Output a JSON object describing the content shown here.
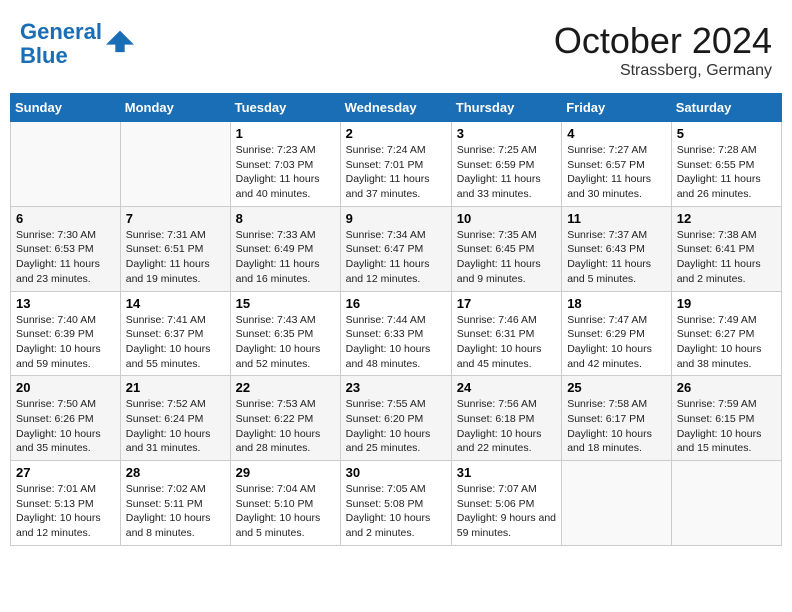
{
  "header": {
    "logo_line1": "General",
    "logo_line2": "Blue",
    "month_title": "October 2024",
    "location": "Strassberg, Germany"
  },
  "weekdays": [
    "Sunday",
    "Monday",
    "Tuesday",
    "Wednesday",
    "Thursday",
    "Friday",
    "Saturday"
  ],
  "weeks": [
    [
      {
        "day": "",
        "sunrise": "",
        "sunset": "",
        "daylight": ""
      },
      {
        "day": "",
        "sunrise": "",
        "sunset": "",
        "daylight": ""
      },
      {
        "day": "1",
        "sunrise": "Sunrise: 7:23 AM",
        "sunset": "Sunset: 7:03 PM",
        "daylight": "Daylight: 11 hours and 40 minutes."
      },
      {
        "day": "2",
        "sunrise": "Sunrise: 7:24 AM",
        "sunset": "Sunset: 7:01 PM",
        "daylight": "Daylight: 11 hours and 37 minutes."
      },
      {
        "day": "3",
        "sunrise": "Sunrise: 7:25 AM",
        "sunset": "Sunset: 6:59 PM",
        "daylight": "Daylight: 11 hours and 33 minutes."
      },
      {
        "day": "4",
        "sunrise": "Sunrise: 7:27 AM",
        "sunset": "Sunset: 6:57 PM",
        "daylight": "Daylight: 11 hours and 30 minutes."
      },
      {
        "day": "5",
        "sunrise": "Sunrise: 7:28 AM",
        "sunset": "Sunset: 6:55 PM",
        "daylight": "Daylight: 11 hours and 26 minutes."
      }
    ],
    [
      {
        "day": "6",
        "sunrise": "Sunrise: 7:30 AM",
        "sunset": "Sunset: 6:53 PM",
        "daylight": "Daylight: 11 hours and 23 minutes."
      },
      {
        "day": "7",
        "sunrise": "Sunrise: 7:31 AM",
        "sunset": "Sunset: 6:51 PM",
        "daylight": "Daylight: 11 hours and 19 minutes."
      },
      {
        "day": "8",
        "sunrise": "Sunrise: 7:33 AM",
        "sunset": "Sunset: 6:49 PM",
        "daylight": "Daylight: 11 hours and 16 minutes."
      },
      {
        "day": "9",
        "sunrise": "Sunrise: 7:34 AM",
        "sunset": "Sunset: 6:47 PM",
        "daylight": "Daylight: 11 hours and 12 minutes."
      },
      {
        "day": "10",
        "sunrise": "Sunrise: 7:35 AM",
        "sunset": "Sunset: 6:45 PM",
        "daylight": "Daylight: 11 hours and 9 minutes."
      },
      {
        "day": "11",
        "sunrise": "Sunrise: 7:37 AM",
        "sunset": "Sunset: 6:43 PM",
        "daylight": "Daylight: 11 hours and 5 minutes."
      },
      {
        "day": "12",
        "sunrise": "Sunrise: 7:38 AM",
        "sunset": "Sunset: 6:41 PM",
        "daylight": "Daylight: 11 hours and 2 minutes."
      }
    ],
    [
      {
        "day": "13",
        "sunrise": "Sunrise: 7:40 AM",
        "sunset": "Sunset: 6:39 PM",
        "daylight": "Daylight: 10 hours and 59 minutes."
      },
      {
        "day": "14",
        "sunrise": "Sunrise: 7:41 AM",
        "sunset": "Sunset: 6:37 PM",
        "daylight": "Daylight: 10 hours and 55 minutes."
      },
      {
        "day": "15",
        "sunrise": "Sunrise: 7:43 AM",
        "sunset": "Sunset: 6:35 PM",
        "daylight": "Daylight: 10 hours and 52 minutes."
      },
      {
        "day": "16",
        "sunrise": "Sunrise: 7:44 AM",
        "sunset": "Sunset: 6:33 PM",
        "daylight": "Daylight: 10 hours and 48 minutes."
      },
      {
        "day": "17",
        "sunrise": "Sunrise: 7:46 AM",
        "sunset": "Sunset: 6:31 PM",
        "daylight": "Daylight: 10 hours and 45 minutes."
      },
      {
        "day": "18",
        "sunrise": "Sunrise: 7:47 AM",
        "sunset": "Sunset: 6:29 PM",
        "daylight": "Daylight: 10 hours and 42 minutes."
      },
      {
        "day": "19",
        "sunrise": "Sunrise: 7:49 AM",
        "sunset": "Sunset: 6:27 PM",
        "daylight": "Daylight: 10 hours and 38 minutes."
      }
    ],
    [
      {
        "day": "20",
        "sunrise": "Sunrise: 7:50 AM",
        "sunset": "Sunset: 6:26 PM",
        "daylight": "Daylight: 10 hours and 35 minutes."
      },
      {
        "day": "21",
        "sunrise": "Sunrise: 7:52 AM",
        "sunset": "Sunset: 6:24 PM",
        "daylight": "Daylight: 10 hours and 31 minutes."
      },
      {
        "day": "22",
        "sunrise": "Sunrise: 7:53 AM",
        "sunset": "Sunset: 6:22 PM",
        "daylight": "Daylight: 10 hours and 28 minutes."
      },
      {
        "day": "23",
        "sunrise": "Sunrise: 7:55 AM",
        "sunset": "Sunset: 6:20 PM",
        "daylight": "Daylight: 10 hours and 25 minutes."
      },
      {
        "day": "24",
        "sunrise": "Sunrise: 7:56 AM",
        "sunset": "Sunset: 6:18 PM",
        "daylight": "Daylight: 10 hours and 22 minutes."
      },
      {
        "day": "25",
        "sunrise": "Sunrise: 7:58 AM",
        "sunset": "Sunset: 6:17 PM",
        "daylight": "Daylight: 10 hours and 18 minutes."
      },
      {
        "day": "26",
        "sunrise": "Sunrise: 7:59 AM",
        "sunset": "Sunset: 6:15 PM",
        "daylight": "Daylight: 10 hours and 15 minutes."
      }
    ],
    [
      {
        "day": "27",
        "sunrise": "Sunrise: 7:01 AM",
        "sunset": "Sunset: 5:13 PM",
        "daylight": "Daylight: 10 hours and 12 minutes."
      },
      {
        "day": "28",
        "sunrise": "Sunrise: 7:02 AM",
        "sunset": "Sunset: 5:11 PM",
        "daylight": "Daylight: 10 hours and 8 minutes."
      },
      {
        "day": "29",
        "sunrise": "Sunrise: 7:04 AM",
        "sunset": "Sunset: 5:10 PM",
        "daylight": "Daylight: 10 hours and 5 minutes."
      },
      {
        "day": "30",
        "sunrise": "Sunrise: 7:05 AM",
        "sunset": "Sunset: 5:08 PM",
        "daylight": "Daylight: 10 hours and 2 minutes."
      },
      {
        "day": "31",
        "sunrise": "Sunrise: 7:07 AM",
        "sunset": "Sunset: 5:06 PM",
        "daylight": "Daylight: 9 hours and 59 minutes."
      },
      {
        "day": "",
        "sunrise": "",
        "sunset": "",
        "daylight": ""
      },
      {
        "day": "",
        "sunrise": "",
        "sunset": "",
        "daylight": ""
      }
    ]
  ]
}
